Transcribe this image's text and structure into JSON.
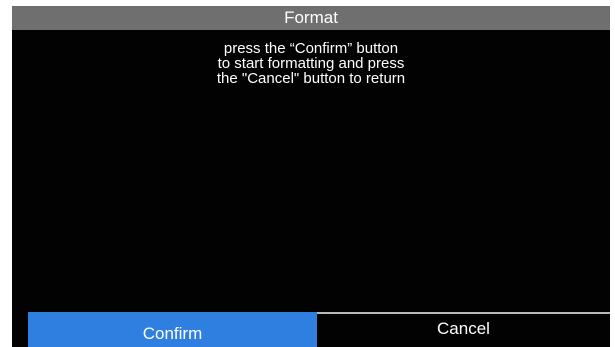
{
  "dialog": {
    "title": "Format",
    "message_lines": [
      "press the “Confirm” button",
      "to start formatting and press",
      "the \"Cancel\" button to return"
    ]
  },
  "buttons": {
    "confirm_label": "Confirm",
    "cancel_label": "Cancel"
  },
  "colors": {
    "background": "#020202",
    "title_bar": "#6f6f6f",
    "confirm_selected": "#2f7fe0",
    "text": "#ffffff"
  }
}
